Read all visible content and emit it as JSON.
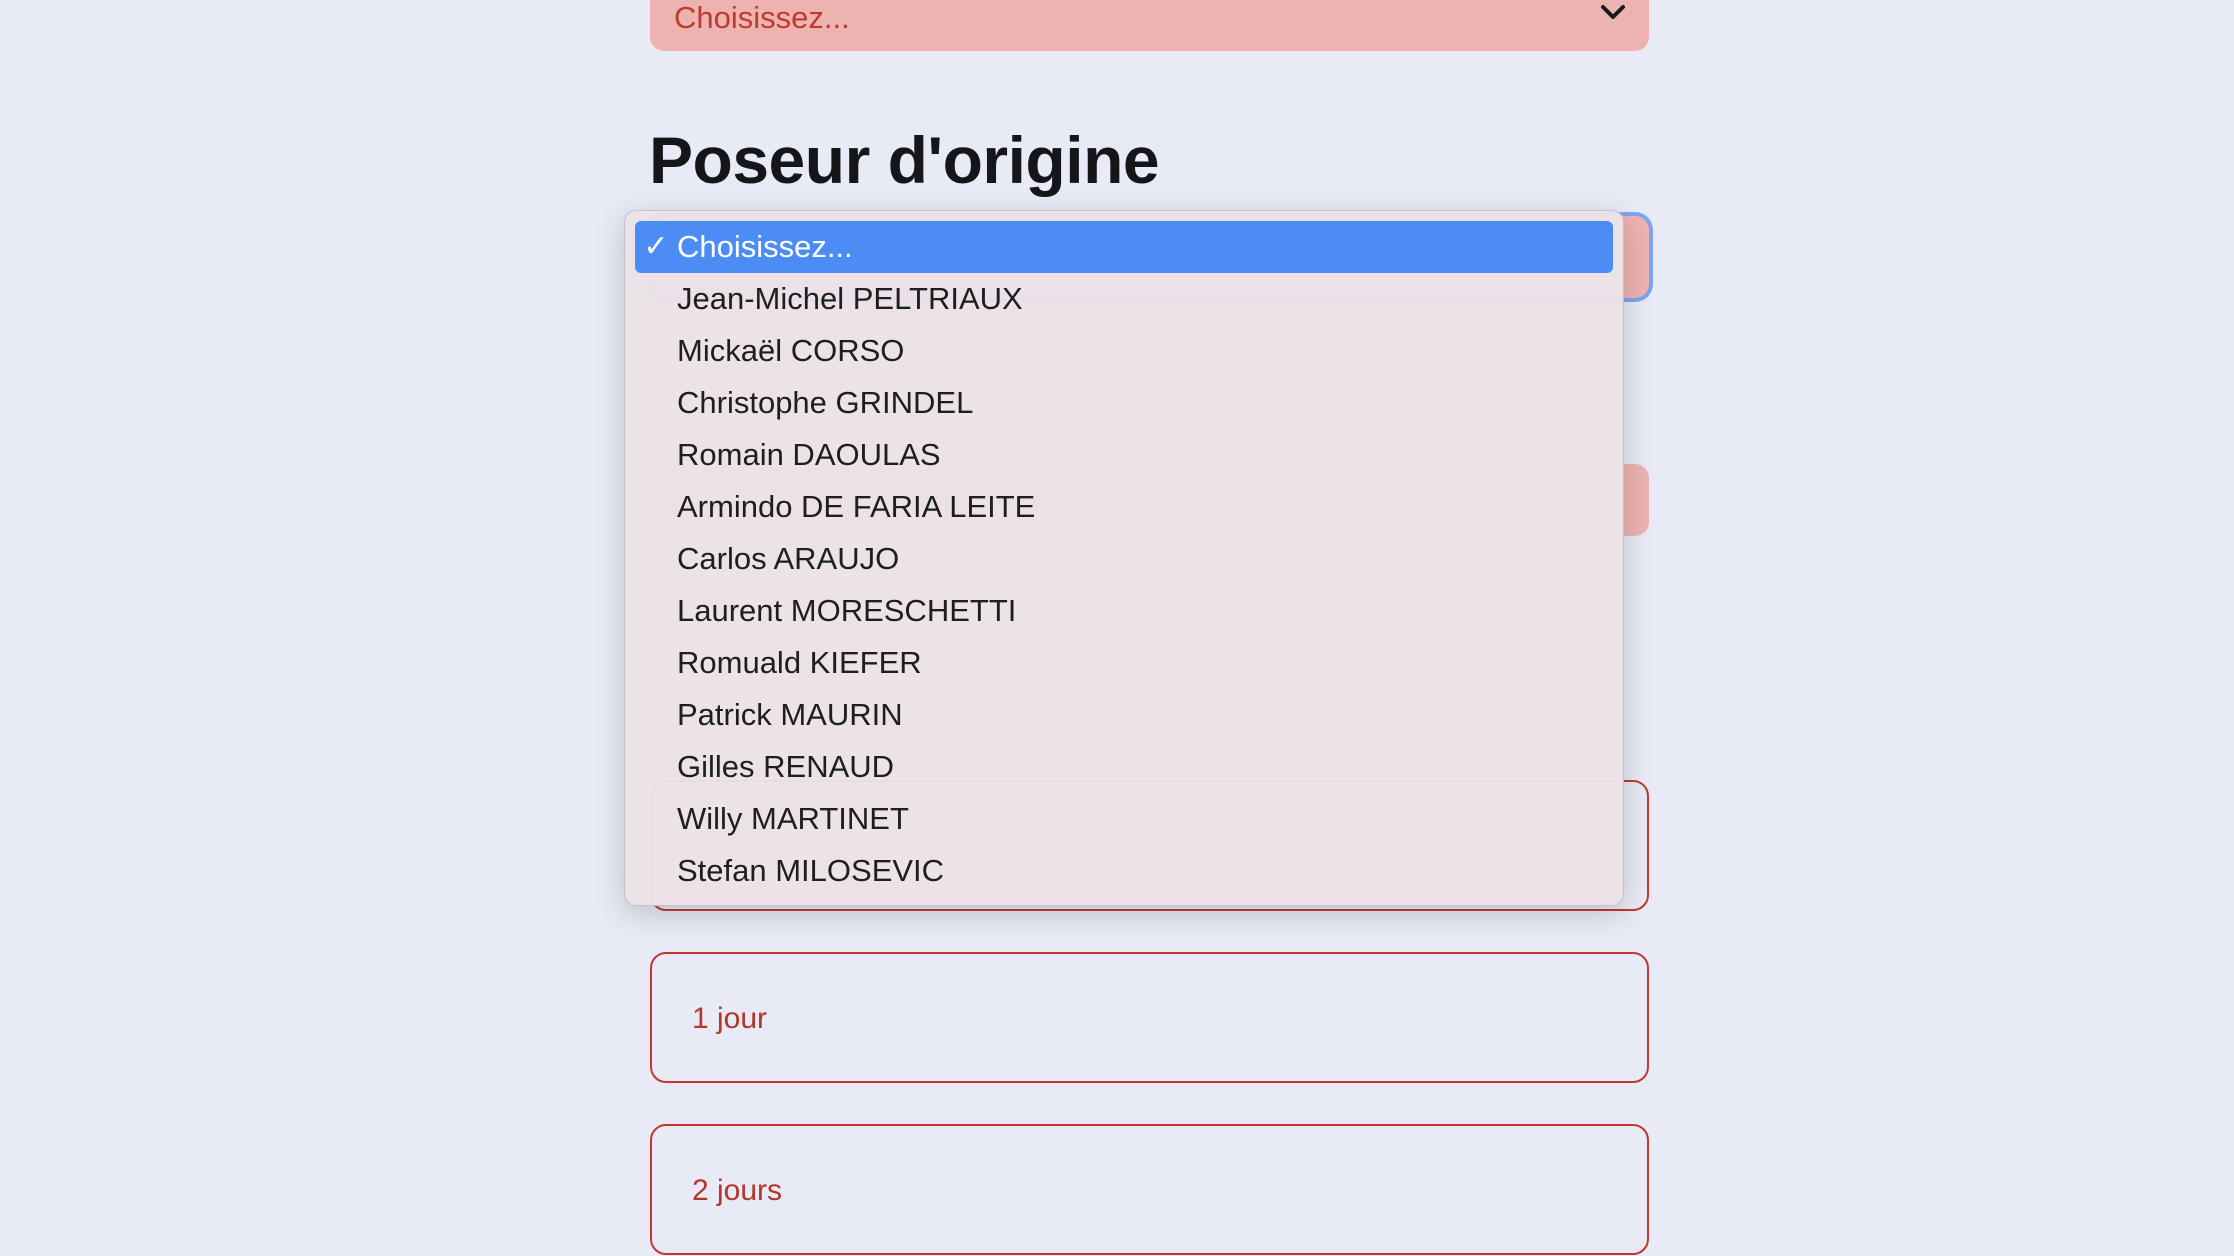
{
  "top_select": {
    "value": "Choisissez..."
  },
  "section": {
    "title": "Poseur d'origine"
  },
  "dropdown": {
    "check_mark": "✓",
    "items": [
      {
        "label": "Choisissez...",
        "selected": true
      },
      {
        "label": "Jean-Michel PELTRIAUX",
        "selected": false
      },
      {
        "label": "Mickaël CORSO",
        "selected": false
      },
      {
        "label": "Christophe GRINDEL",
        "selected": false
      },
      {
        "label": "Romain DAOULAS",
        "selected": false
      },
      {
        "label": "Armindo DE FARIA LEITE",
        "selected": false
      },
      {
        "label": "Carlos ARAUJO",
        "selected": false
      },
      {
        "label": "Laurent MORESCHETTI",
        "selected": false
      },
      {
        "label": "Romuald KIEFER",
        "selected": false
      },
      {
        "label": "Patrick MAURIN",
        "selected": false
      },
      {
        "label": "Gilles RENAUD",
        "selected": false
      },
      {
        "label": "Willy MARTINET",
        "selected": false
      },
      {
        "label": "Stefan MILOSEVIC",
        "selected": false
      }
    ]
  },
  "options": [
    {
      "label": ""
    },
    {
      "label": "1 jour"
    },
    {
      "label": "2 jours"
    }
  ],
  "colors": {
    "background": "#e8ebf5",
    "select_fill": "#ecb3b1",
    "accent_red": "#c0392f",
    "highlight_blue": "#4b8df5"
  }
}
